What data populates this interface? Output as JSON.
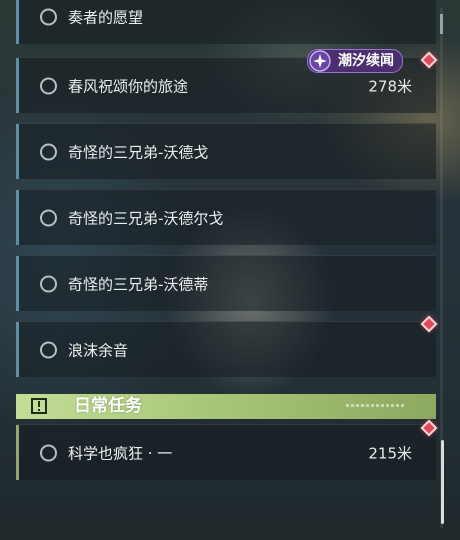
{
  "quests": [
    {
      "title": "奏者的愿望",
      "distance": ""
    },
    {
      "title": "春风祝颂你的旅途",
      "distance": "278米"
    },
    {
      "title": "奇怪的三兄弟-沃德戈",
      "distance": ""
    },
    {
      "title": "奇怪的三兄弟-沃德尔戈",
      "distance": ""
    },
    {
      "title": "奇怪的三兄弟-沃德蒂",
      "distance": ""
    },
    {
      "title": "浪沫余音",
      "distance": ""
    }
  ],
  "event_badge": {
    "label": "潮汐续闻"
  },
  "daily_section": {
    "label": "日常任务",
    "quests": [
      {
        "title": "科学也疯狂 · 一",
        "distance": "215米"
      }
    ]
  },
  "colors": {
    "accent_blue": "#5f8fa3",
    "accent_green": "#8fa872",
    "marker_red": "#e0495b",
    "badge_purple": "#4a2e6e"
  }
}
